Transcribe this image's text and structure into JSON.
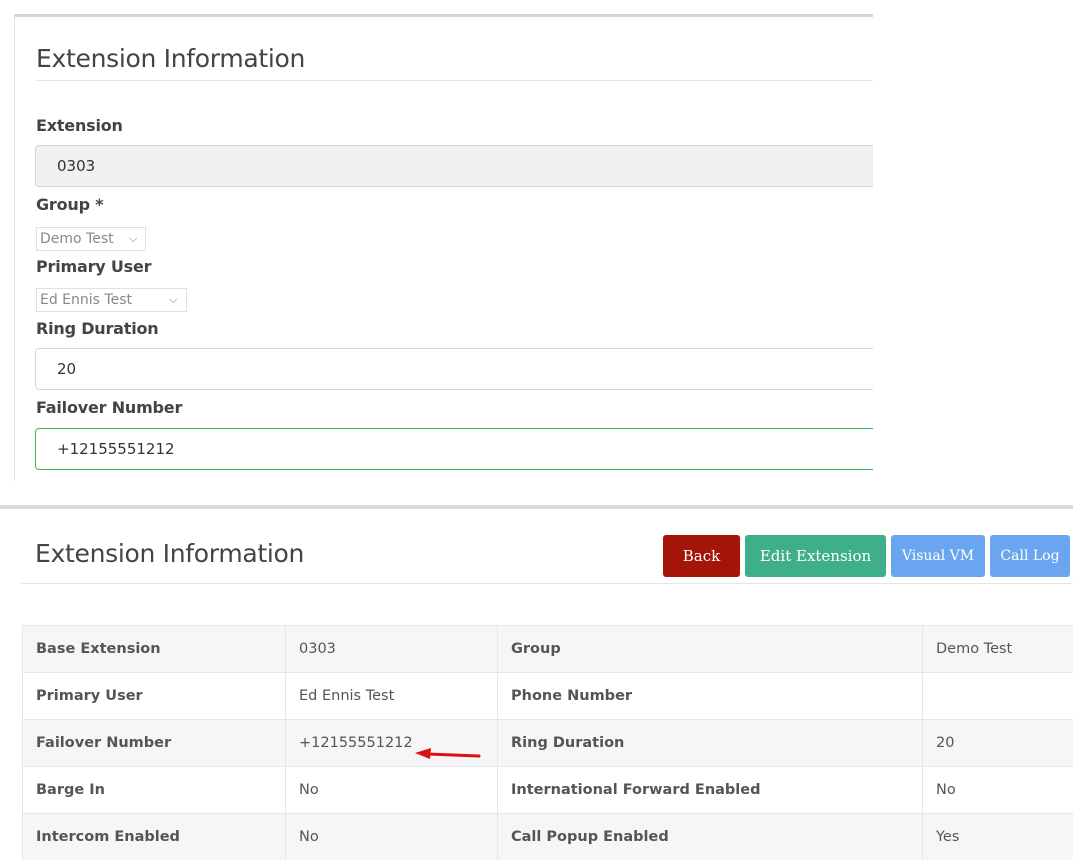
{
  "edit_form": {
    "title": "Extension Information",
    "extension": {
      "label": "Extension",
      "value": "0303"
    },
    "group": {
      "label": "Group *",
      "selected": "Demo Test"
    },
    "primary_user": {
      "label": "Primary User",
      "selected": "Ed Ennis Test"
    },
    "ring_duration": {
      "label": "Ring Duration",
      "value": "20"
    },
    "failover_number": {
      "label": "Failover Number",
      "value": "+12155551212"
    }
  },
  "view": {
    "title": "Extension Information",
    "buttons": {
      "back": "Back",
      "edit": "Edit Extension",
      "visual_vm": "Visual VM",
      "call_log": "Call Log"
    },
    "rows": [
      {
        "k1": "Base Extension",
        "v1": "0303",
        "k2": "Group",
        "v2": "Demo Test"
      },
      {
        "k1": "Primary User",
        "v1": "Ed Ennis Test",
        "k2": "Phone Number",
        "v2": ""
      },
      {
        "k1": "Failover Number",
        "v1": "+12155551212",
        "k2": "Ring Duration",
        "v2": "20"
      },
      {
        "k1": "Barge In",
        "v1": "No",
        "k2": "International Forward Enabled",
        "v2": "No"
      },
      {
        "k1": "Intercom Enabled",
        "v1": "No",
        "k2": "Call Popup Enabled",
        "v2": "Yes"
      }
    ]
  },
  "colors": {
    "back_button": "#a51409",
    "edit_button": "#3fae8a",
    "secondary_buttons": "#6aa6f0",
    "success_border": "#3cba54",
    "annotation_arrow": "#e01010"
  },
  "icons": [
    "chevron-down-icon",
    "red-arrow-annotation"
  ]
}
